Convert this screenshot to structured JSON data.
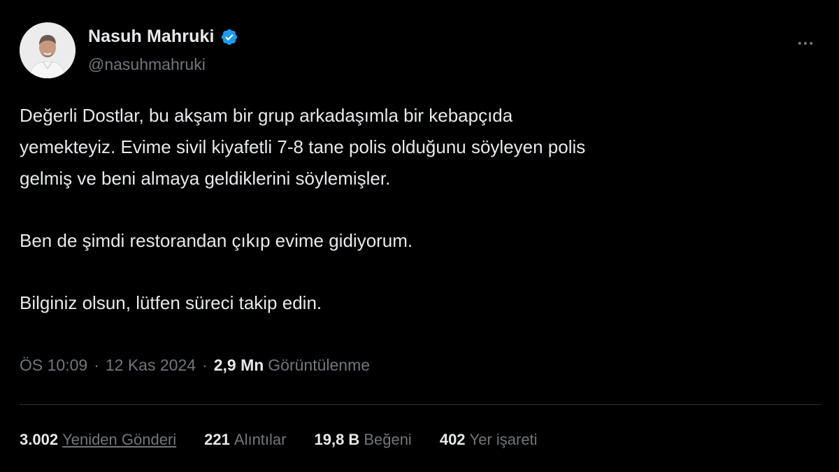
{
  "author": {
    "display_name": "Nasuh Mahruki",
    "handle": "@nasuhmahruki",
    "verified": true,
    "verified_color": "#1d9bf0"
  },
  "tweet": {
    "paragraphs": [
      "Değerli Dostlar, bu akşam bir grup arkadaşımla bir kebapçıda\nyemekteyiz. Evime sivil kiyafetli 7-8 tane polis olduğunu söyleyen polis\ngelmiş ve beni almaya geldiklerini söylemişler.",
      "Ben de şimdi restorandan çıkıp evime gidiyorum.",
      "Bilginiz olsun, lütfen süreci takip edin."
    ]
  },
  "meta": {
    "time": "ÖS 10:09",
    "separator": "·",
    "date": "12 Kas 2024",
    "views_count": "2,9 Mn",
    "views_label": "Görüntülenme"
  },
  "stats": {
    "retweets": {
      "count": "3.002",
      "label": "Yeniden Gönderi"
    },
    "quotes": {
      "count": "221",
      "label": "Alıntılar"
    },
    "likes": {
      "count": "19,8 B",
      "label": "Beğeni"
    },
    "bookmarks": {
      "count": "402",
      "label": "Yer işareti"
    }
  },
  "icons": {
    "more": "more-horizontal-icon",
    "verified": "verified-badge-icon"
  },
  "colors": {
    "background": "#000000",
    "text_primary": "#e7e9ea",
    "text_secondary": "#71767b",
    "divider": "#2f3336"
  }
}
